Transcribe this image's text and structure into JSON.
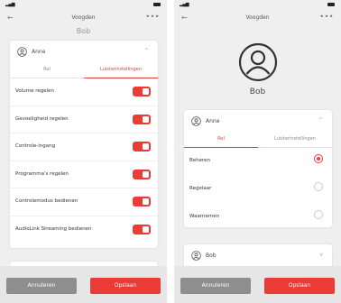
{
  "left": {
    "nav_title": "Voogden",
    "header_name_partial": "Bob",
    "user_name": "Anne",
    "tabs": [
      "Rol",
      "Luisterinstellingen"
    ],
    "active_tab": 1,
    "settings": [
      {
        "label": "Volume regelen",
        "on": true
      },
      {
        "label": "Gevoeligheid regelen",
        "on": true
      },
      {
        "label": "Controle-ingang",
        "on": true
      },
      {
        "label": "Programma's regelen",
        "on": true
      },
      {
        "label": "Controlemodus bedienen",
        "on": true
      },
      {
        "label": "AudioLink Streaming bedienen",
        "on": true
      }
    ],
    "cancel_label": "Annuleren",
    "save_label": "Opslaan"
  },
  "right": {
    "nav_title": "Voogden",
    "header_name": "Bob",
    "card1": {
      "user_name": "Anne",
      "tabs": [
        "Rol",
        "Luisterinstellingen"
      ],
      "active_tab": 0,
      "roles": [
        {
          "label": "Beheren",
          "selected": true
        },
        {
          "label": "Regelaar",
          "selected": false
        },
        {
          "label": "Waarnemen",
          "selected": false
        }
      ]
    },
    "card2": {
      "user_name": "Bob"
    },
    "cancel_label": "Annuleren",
    "save_label": "Opslaan"
  },
  "colors": {
    "accent": "#ea3b36",
    "cancel": "#8e8e8e",
    "background": "#efefef"
  },
  "icons": {
    "back": "arrow-left-icon",
    "more": "more-dots-icon",
    "avatar": "user-avatar-icon",
    "chevron": "chevron-up-icon"
  }
}
